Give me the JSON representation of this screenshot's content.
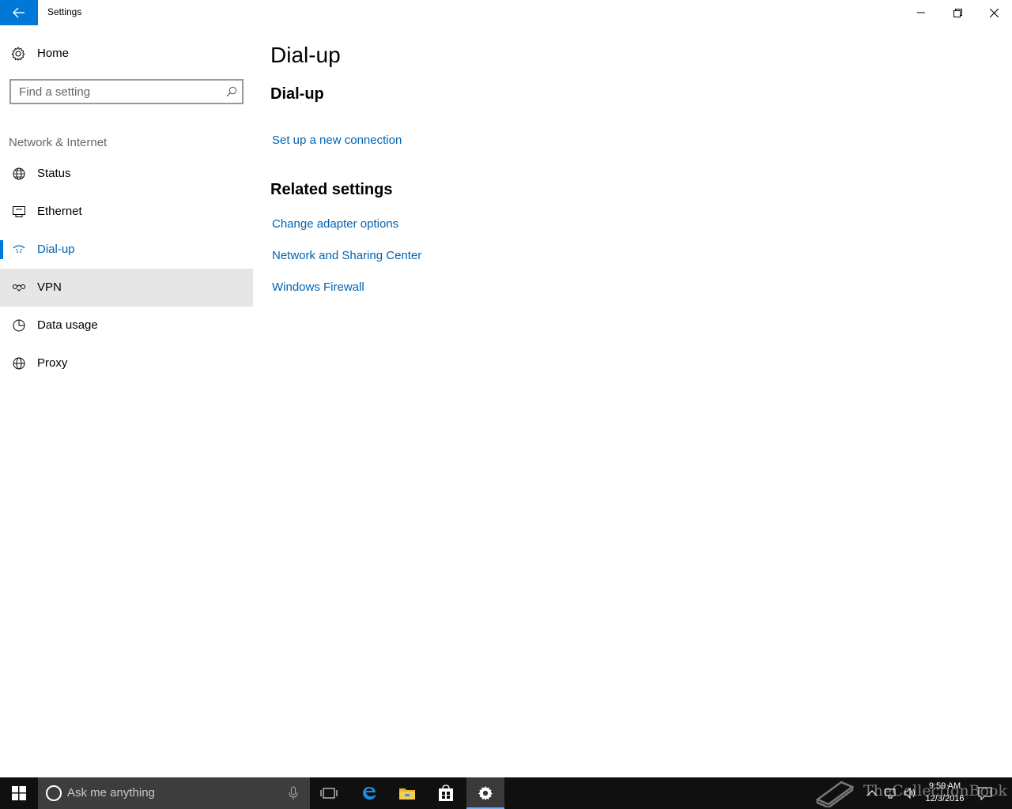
{
  "window": {
    "title": "Settings",
    "back_icon": "arrow-left-icon",
    "controls": [
      "minimize-icon",
      "maximize-icon",
      "close-icon"
    ]
  },
  "sidebar": {
    "home_label": "Home",
    "search_placeholder": "Find a setting",
    "section_title": "Network & Internet",
    "items": [
      {
        "label": "Status",
        "icon": "globe-status-icon"
      },
      {
        "label": "Ethernet",
        "icon": "ethernet-icon"
      },
      {
        "label": "Dial-up",
        "icon": "dialup-icon",
        "selected": true
      },
      {
        "label": "VPN",
        "icon": "vpn-icon",
        "hovered": true
      },
      {
        "label": "Data usage",
        "icon": "data-usage-icon"
      },
      {
        "label": "Proxy",
        "icon": "globe-icon"
      }
    ]
  },
  "main": {
    "page_title": "Dial-up",
    "section_title": "Dial-up",
    "setup_link": "Set up a new connection",
    "related_title": "Related settings",
    "related_links": [
      "Change adapter options",
      "Network and Sharing Center",
      "Windows Firewall"
    ]
  },
  "taskbar": {
    "search_placeholder": "Ask me anything",
    "clock_time": "9:59 AM",
    "clock_date": "12/3/2016",
    "watermark": "TheCollectionBook"
  },
  "colors": {
    "accent": "#0078d7",
    "link": "#0063b1",
    "hover": "#e6e6e6",
    "taskbar": "#101010"
  }
}
